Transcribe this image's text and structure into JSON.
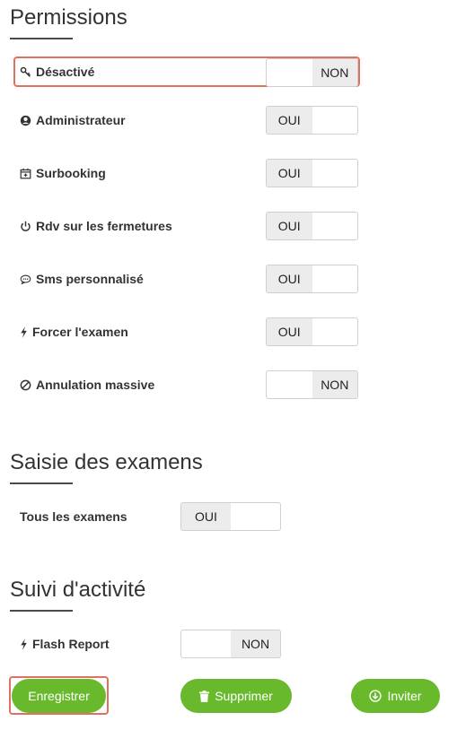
{
  "sections": {
    "permissions": "Permissions",
    "saisie": "Saisie des examens",
    "suivi": "Suivi d'activité"
  },
  "permissions": [
    {
      "label": "Désactivé",
      "icon": "key-icon",
      "state": "NON"
    },
    {
      "label": "Administrateur",
      "icon": "user-circle-icon",
      "state": "OUI"
    },
    {
      "label": "Surbooking",
      "icon": "calendar-plus-icon",
      "state": "OUI"
    },
    {
      "label": "Rdv sur les fermetures",
      "icon": "power-icon",
      "state": "OUI"
    },
    {
      "label": "Sms personnalisé",
      "icon": "chat-bubble-icon",
      "state": "OUI"
    },
    {
      "label": "Forcer l'examen",
      "icon": "bolt-icon",
      "state": "OUI"
    },
    {
      "label": "Annulation massive",
      "icon": "ban-icon",
      "state": "NON"
    }
  ],
  "saisie": {
    "label": "Tous les examens",
    "state": "OUI"
  },
  "suivi": {
    "label": "Flash Report",
    "icon": "bolt-icon",
    "state": "NON"
  },
  "toggle_labels": {
    "on": "OUI",
    "off": "NON"
  },
  "buttons": {
    "save": "Enregistrer",
    "delete": "Supprimer",
    "invite": "Inviter"
  },
  "colors": {
    "accent": "#69b92d",
    "highlight": "#e07060"
  }
}
